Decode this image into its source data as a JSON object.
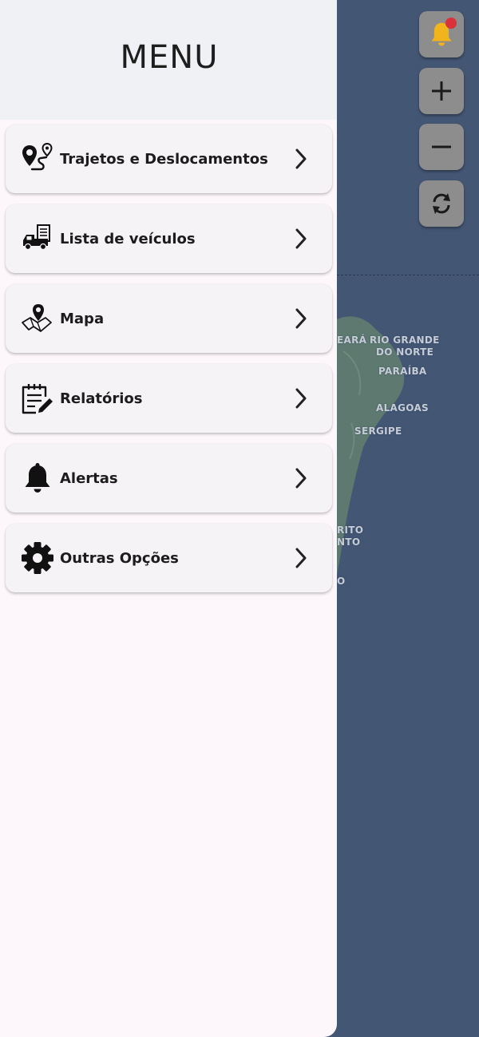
{
  "drawer": {
    "title": "MENU",
    "items": [
      {
        "label": "Trajetos e Deslocamentos",
        "icon": "route-pins-icon"
      },
      {
        "label": "Lista de veículos",
        "icon": "truck-document-icon"
      },
      {
        "label": "Mapa",
        "icon": "map-pin-icon"
      },
      {
        "label": "Relatórios",
        "icon": "report-edit-icon"
      },
      {
        "label": "Alertas",
        "icon": "bell-icon"
      },
      {
        "label": "Outras Opções",
        "icon": "gear-icon"
      }
    ]
  },
  "map": {
    "labels": {
      "ceara": "EARÁ",
      "rio_grande_line1": "RIO GRANDE",
      "rio_grande_line2": "DO NORTE",
      "paraiba": "PARAÍBA",
      "alagoas": "ALAGOAS",
      "sergipe": "SERGIPE",
      "espirito_line1": "RITO",
      "espirito_line2": "NTO",
      "rio_fragment": "O"
    }
  },
  "map_controls": {
    "alert_button_icon": "bell-icon",
    "zoom_in_icon": "plus-icon",
    "zoom_out_icon": "minus-icon",
    "refresh_icon": "refresh-icon"
  },
  "colors": {
    "map_ocean": "#435674",
    "drawer_background": "#fdf7fc",
    "drawer_header": "#eff1f4",
    "menu_card": "#f6f3f7",
    "control_button": "#8d8d8d",
    "notification_bell": "#f2b41c",
    "notification_dot": "#d9323a"
  }
}
